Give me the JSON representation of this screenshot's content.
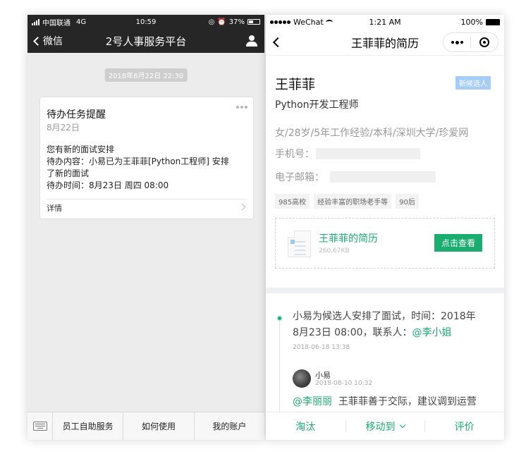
{
  "left_phone": {
    "status": {
      "carrier": "中国联通",
      "network": "4G",
      "time": "10:59",
      "battery": "37%"
    },
    "nav": {
      "back_label": "微信",
      "title": "2号人事服务平台"
    },
    "chat": {
      "timestamp": "2018年8月22日 22:30",
      "card": {
        "title": "待办任务提醒",
        "date": "8月22日",
        "lines": [
          "您有新的面试安排",
          "待办内容：小易已为王菲菲[Python工程师] 安排",
          "了新的面试",
          "待办时间：8月23日 周四 08:00"
        ],
        "detail_label": "详情"
      }
    },
    "menu": [
      "员工自助服务",
      "如何使用",
      "我的账户"
    ]
  },
  "right_phone": {
    "status": {
      "carrier": "WeChat",
      "time": "1:21 AM",
      "battery": "100%"
    },
    "nav": {
      "title": "王菲菲的简历"
    },
    "profile": {
      "name": "王菲菲",
      "badge": "新候选人",
      "job": "Python开发工程师",
      "info": "女/28岁/5年工作经验/本科/深圳大学/珍爱网",
      "phone_label": "手机号：",
      "email_label": "电子邮箱：",
      "tags": [
        "985高校",
        "经验丰富的职场老手等",
        "90后"
      ]
    },
    "file": {
      "name": "王菲菲的简历",
      "size": "260.67KB",
      "view_label": "点击查看"
    },
    "timeline": {
      "event_prefix": "小易为候选人安排了面试，时间：2018年",
      "event_line2": "8月23日 08:00，联系人：",
      "event_contact": "@李小姐",
      "event_time": "2018-06-18 13:38",
      "comment": {
        "author": "小易",
        "time": "2018-08-10 10:32",
        "mention": "@李丽丽",
        "text": "王菲菲善于交际，建议调到运营"
      }
    },
    "actions": {
      "reject": "淘汰",
      "move": "移动到",
      "review": "评价"
    }
  },
  "colors": {
    "wechat_green": "#1aad6f",
    "dark_bar": "#262626",
    "badge_blue": "#a5cdf5"
  }
}
